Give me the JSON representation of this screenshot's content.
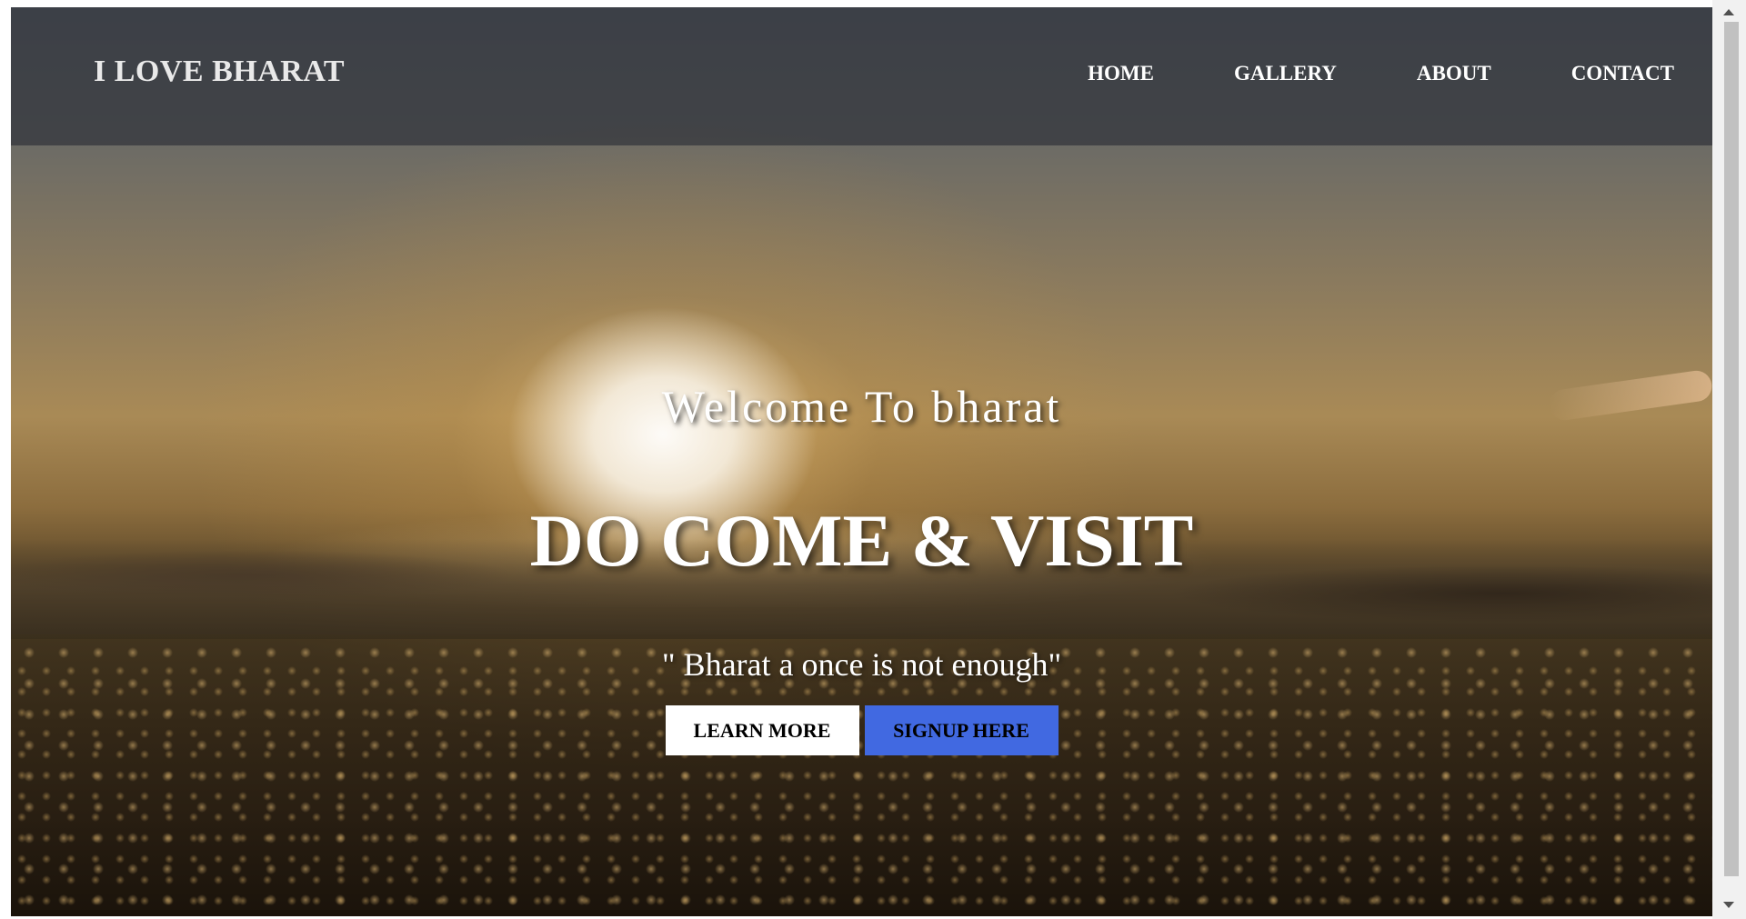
{
  "navbar": {
    "logo": "I LOVE BHARAT",
    "links": [
      {
        "label": "HOME"
      },
      {
        "label": "GALLERY"
      },
      {
        "label": "ABOUT"
      },
      {
        "label": "CONTACT"
      }
    ]
  },
  "hero": {
    "welcome": "Welcome To bharat",
    "headline": "DO COME & VISIT",
    "tagline": "\" Bharat a once is not enough\"",
    "learn_more_label": "LEARN MORE",
    "signup_label": "SIGNUP HERE"
  },
  "colors": {
    "signup_button": "#4169e1",
    "learn_button": "#ffffff",
    "navbar": "#282c34"
  },
  "icons": {
    "scroll_up": "scroll-up-arrow-icon",
    "scroll_down": "scroll-down-arrow-icon"
  }
}
